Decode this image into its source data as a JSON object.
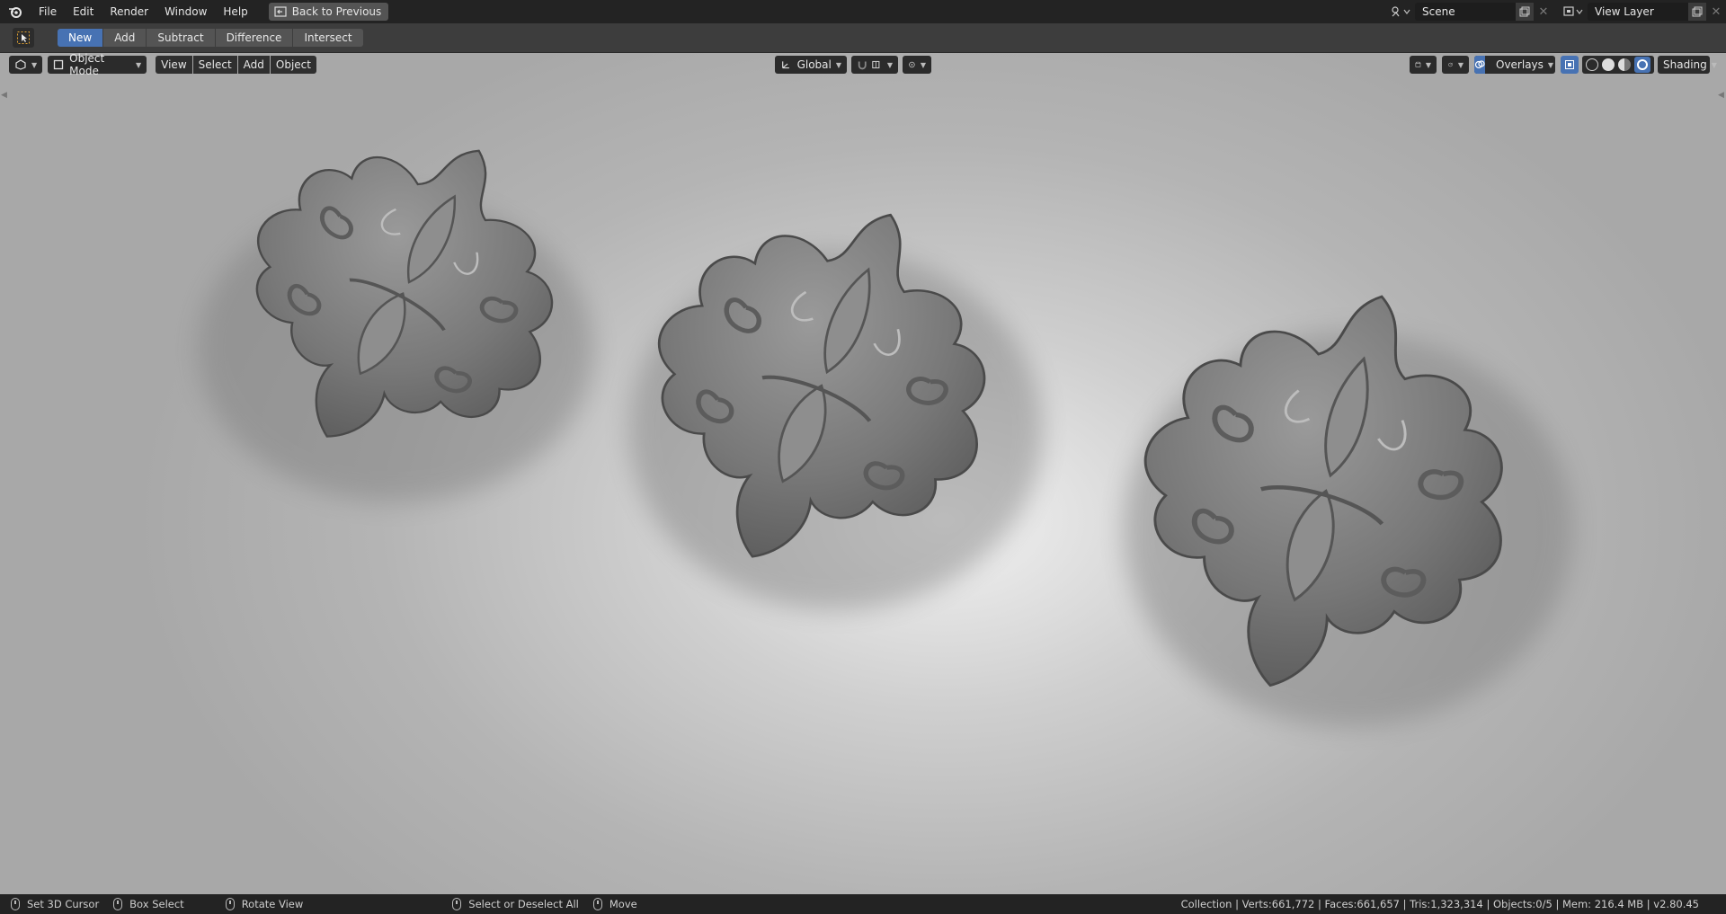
{
  "topbar": {
    "menus": [
      "File",
      "Edit",
      "Render",
      "Window",
      "Help"
    ],
    "back_button": "Back to Previous",
    "scene_name": "Scene",
    "view_layer": "View Layer"
  },
  "tool_settings": {
    "modes": [
      "New",
      "Add",
      "Subtract",
      "Difference",
      "Intersect"
    ],
    "active_mode": "New"
  },
  "viewport_header": {
    "interaction_mode": "Object Mode",
    "menus": [
      "View",
      "Select",
      "Add",
      "Object"
    ],
    "transform_orientation": "Global",
    "overlays_label": "Overlays",
    "shading_label": "Shading"
  },
  "statusbar": {
    "hints": [
      "Set 3D Cursor",
      "Box Select",
      "Rotate View",
      "Select or Deselect All",
      "Move"
    ],
    "info": "Collection | Verts:661,772 | Faces:661,657 | Tris:1,323,314 | Objects:0/5 | Mem: 216.4 MB | v2.80.45"
  },
  "colors": {
    "accent": "#4772b3",
    "header_bg": "#232323",
    "toolbar_bg": "#3d3d3d"
  }
}
